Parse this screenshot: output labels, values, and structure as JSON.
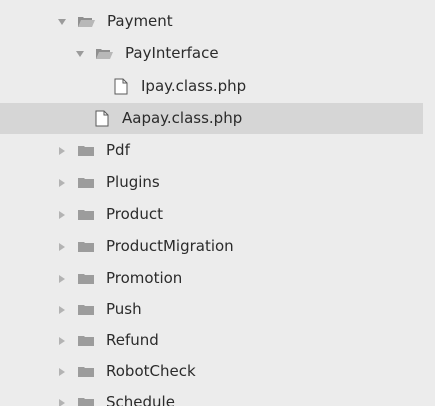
{
  "explorer": {
    "items": [
      {
        "label": "Payment",
        "type": "folder",
        "state": "expanded"
      },
      {
        "label": "PayInterface",
        "type": "folder",
        "state": "expanded"
      },
      {
        "label": "Ipay.class.php",
        "type": "file"
      },
      {
        "label": "Aapay.class.php",
        "type": "file",
        "selected": true
      },
      {
        "label": "Pdf",
        "type": "folder",
        "state": "collapsed"
      },
      {
        "label": "Plugins",
        "type": "folder",
        "state": "collapsed"
      },
      {
        "label": "Product",
        "type": "folder",
        "state": "collapsed"
      },
      {
        "label": "ProductMigration",
        "type": "folder",
        "state": "collapsed"
      },
      {
        "label": "Promotion",
        "type": "folder",
        "state": "collapsed"
      },
      {
        "label": "Push",
        "type": "folder",
        "state": "collapsed"
      },
      {
        "label": "Refund",
        "type": "folder",
        "state": "collapsed"
      },
      {
        "label": "RobotCheck",
        "type": "folder",
        "state": "collapsed"
      },
      {
        "label": "Schedule",
        "type": "folder",
        "state": "collapsed"
      }
    ]
  },
  "icons": {
    "folder": "folder-icon",
    "folder_open": "folder-open-icon",
    "file": "file-icon",
    "expand": "chevron-right-icon",
    "collapse": "chevron-down-icon"
  },
  "colors": {
    "background": "#ececec",
    "selected_row": "#d6d6d6",
    "folder_fill": "#9c9c9c",
    "text": "#2b2b2b"
  }
}
